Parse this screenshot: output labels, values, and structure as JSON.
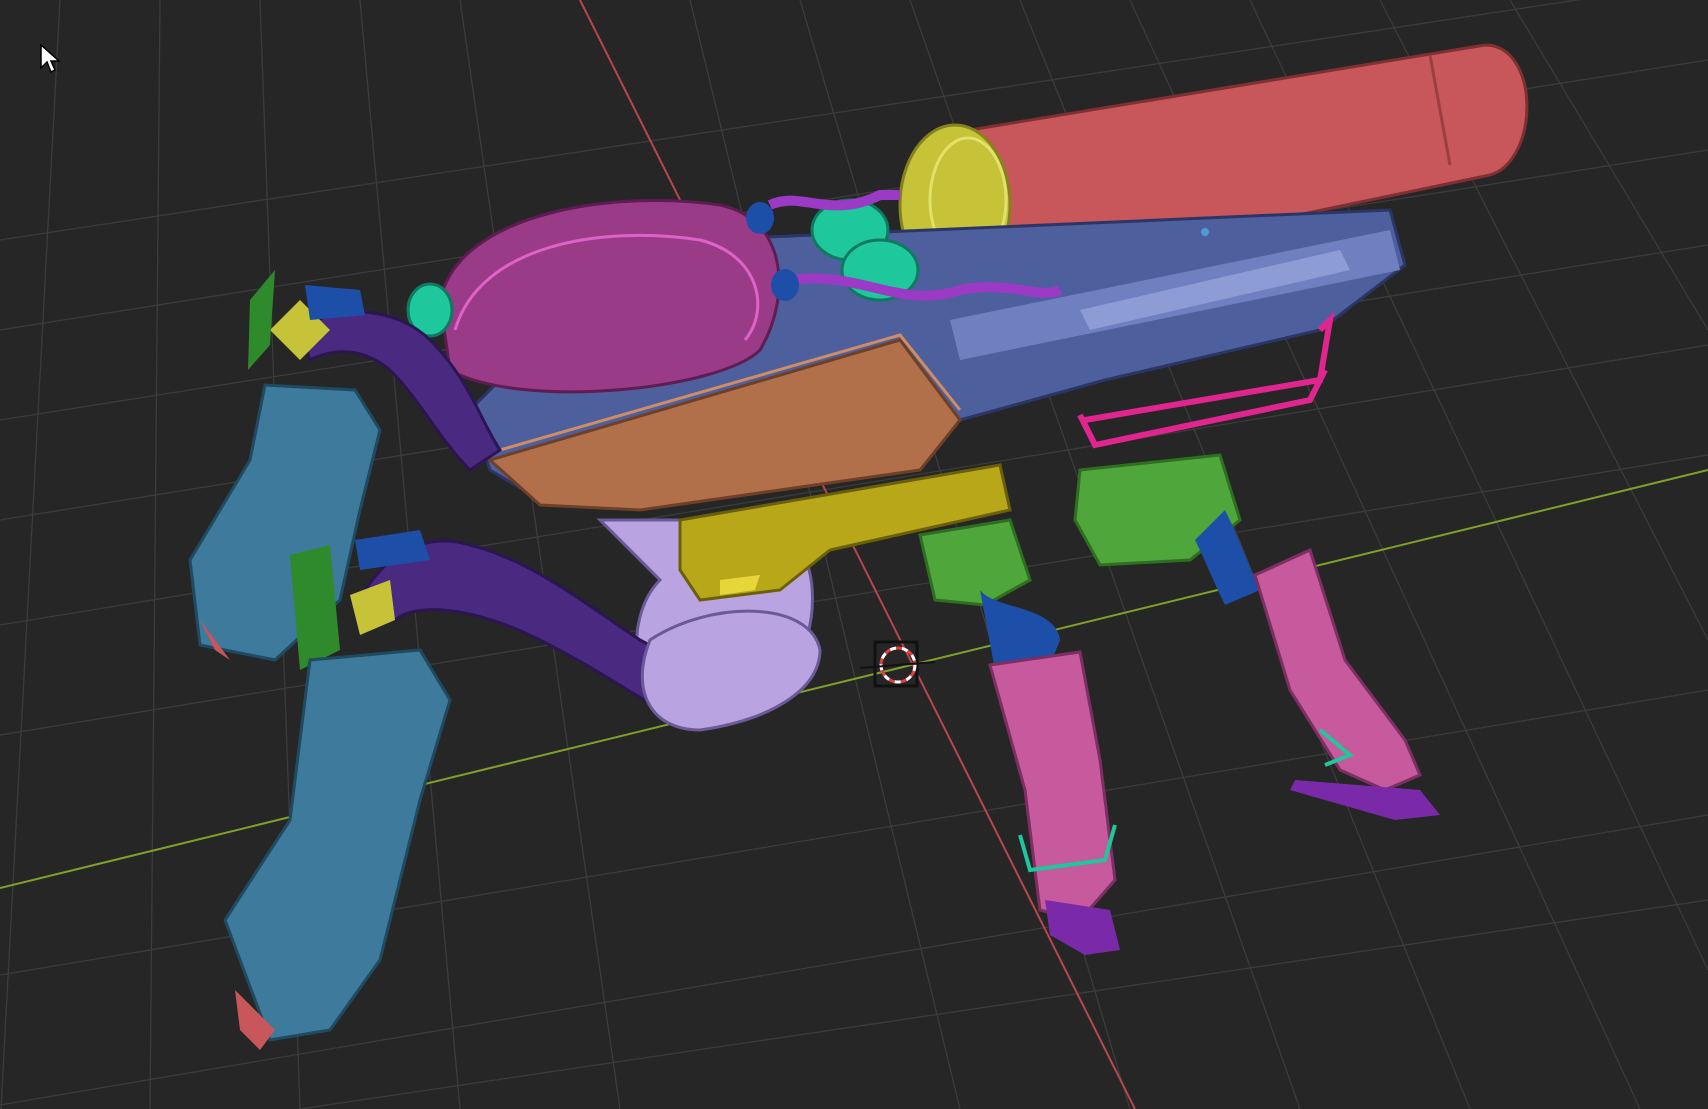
{
  "viewport": {
    "background_color": "#262626",
    "grid_color": "#3c3c3c",
    "x_axis_color": "#7fa02a",
    "y_axis_color": "#b8474a"
  },
  "model": {
    "part_colors": {
      "tank": "#c7575a",
      "tank_cap": "#c6c338",
      "hull_top": "#b2704a",
      "hull_front": "#4e5f9e",
      "pod": "#9a3b88",
      "tubes": "#4a2a80",
      "legs_front": "#3d7a9c",
      "legs_rear": "#c75a9d",
      "bumper_front": "#b9a71a",
      "bumper_rear": "#4fa63a",
      "joints": "#1e4fa8",
      "feet": "#7a2aa8",
      "handle": "#e0258f",
      "connectors": "#1ec79c"
    }
  },
  "icons": {
    "cursor": "mouse-pointer-icon",
    "pivot": "pivot-gizmo-icon",
    "origin": "origin-point-icon"
  }
}
